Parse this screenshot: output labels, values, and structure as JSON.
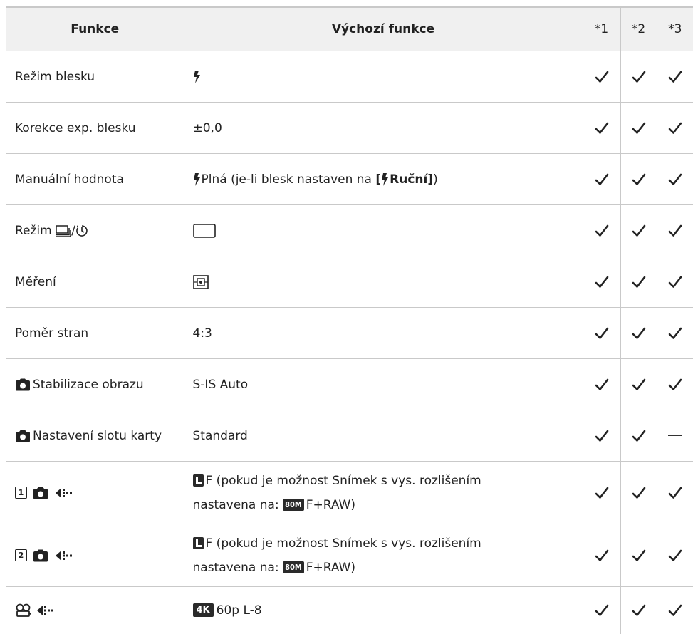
{
  "table": {
    "headers": {
      "function": "Funkce",
      "default": "Výchozí funkce",
      "col1": "*1",
      "col2": "*2",
      "col3": "*3"
    },
    "rows": [
      {
        "function": "Režim blesku",
        "default_text": "",
        "marks": [
          "check",
          "check",
          "check"
        ]
      },
      {
        "function": "Korekce exp. blesku",
        "default_text": "±0,0",
        "marks": [
          "check",
          "check",
          "check"
        ]
      },
      {
        "function": "Manuální hodnota",
        "default_text": "Plná (je-li blesk nastaven na ",
        "default_bracket_open": "[",
        "default_bold": "Ruční",
        "default_bracket_close": "]",
        "default_tail": ")",
        "marks": [
          "check",
          "check",
          "check"
        ]
      },
      {
        "function_prefix": "Režim ",
        "function_suffix": "/",
        "default_text": "",
        "marks": [
          "check",
          "check",
          "check"
        ]
      },
      {
        "function": "Měření",
        "default_text": "",
        "marks": [
          "check",
          "check",
          "check"
        ]
      },
      {
        "function": "Poměr stran",
        "default_text": "4:3",
        "marks": [
          "check",
          "check",
          "check"
        ]
      },
      {
        "function": "Stabilizace obrazu",
        "default_text": "S-IS Auto",
        "marks": [
          "check",
          "check",
          "check"
        ]
      },
      {
        "function": "Nastavení slotu karty",
        "default_text": "Standard",
        "marks": [
          "check",
          "check",
          "dash"
        ]
      },
      {
        "function_num": "1",
        "default_line1": "F (pokud je možnost Snímek s vys. rozlišením",
        "default_line2_prefix": "nastavena na: ",
        "default_icon_text": "80M",
        "default_line2_suffix": "F+RAW)",
        "marks": [
          "check",
          "check",
          "check"
        ]
      },
      {
        "function_num": "2",
        "default_line1": "F (pokud je možnost Snímek s vys. rozlišením",
        "default_line2_prefix": "nastavena na: ",
        "default_icon_text": "80M",
        "default_line2_suffix": "F+RAW)",
        "marks": [
          "check",
          "check",
          "check"
        ]
      },
      {
        "default_icon_text": "4K",
        "default_text": "60p L-8",
        "marks": [
          "check",
          "check",
          "check"
        ]
      }
    ]
  },
  "icons": {
    "flash": "flash-icon",
    "sequential": "sequential-shooting-icon",
    "self_timer": "self-timer-icon",
    "single_frame": "single-frame-icon",
    "metering": "metering-icon",
    "camera": "camera-icon",
    "image_quality": "image-quality-icon",
    "movie": "movie-icon",
    "check": "check-icon"
  },
  "colors": {
    "header_bg": "#f0f0f0",
    "border": "#c9c9c9",
    "text": "#222222"
  }
}
